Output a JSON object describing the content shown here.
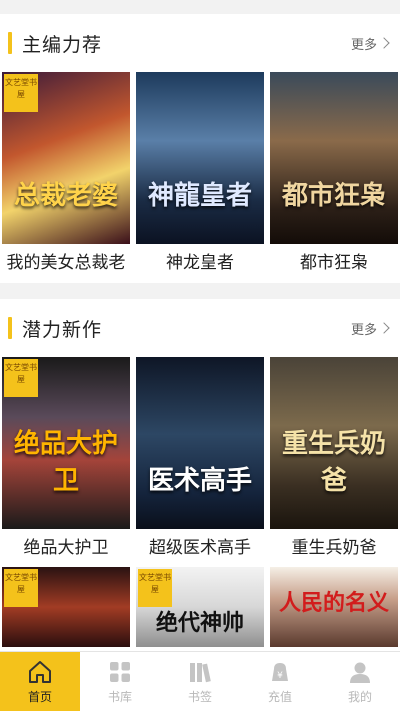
{
  "sections": [
    {
      "title": "主编力荐",
      "more": "更多",
      "books": [
        {
          "title": "我的美女总裁老",
          "cover_text": "总裁老婆",
          "badge": "文艺堂书屋"
        },
        {
          "title": "神龙皇者",
          "cover_text": "神龍皇者",
          "badge": ""
        },
        {
          "title": "都市狂枭",
          "cover_text": "都市狂枭",
          "badge": ""
        }
      ]
    },
    {
      "title": "潜力新作",
      "more": "更多",
      "books": [
        {
          "title": "绝品大护卫",
          "cover_text": "绝品大护卫",
          "badge": "文艺堂书屋"
        },
        {
          "title": "超级医术高手",
          "cover_text": "医术高手",
          "badge": ""
        },
        {
          "title": "重生兵奶爸",
          "cover_text": "重生兵奶爸",
          "badge": ""
        }
      ],
      "more_books": [
        {
          "title": "",
          "cover_text": "",
          "badge": "文艺堂书屋"
        },
        {
          "title": "",
          "cover_text": "绝代神帅",
          "badge": "文艺堂书屋"
        },
        {
          "title": "",
          "cover_text": "人民的名义",
          "badge": ""
        }
      ]
    }
  ],
  "tabbar": [
    {
      "label": "首页",
      "icon": "home-icon",
      "active": true
    },
    {
      "label": "书库",
      "icon": "grid-icon",
      "active": false
    },
    {
      "label": "书签",
      "icon": "books-icon",
      "active": false
    },
    {
      "label": "充值",
      "icon": "recharge-icon",
      "active": false
    },
    {
      "label": "我的",
      "icon": "user-icon",
      "active": false
    }
  ],
  "colors": {
    "accent": "#f4c21b"
  }
}
